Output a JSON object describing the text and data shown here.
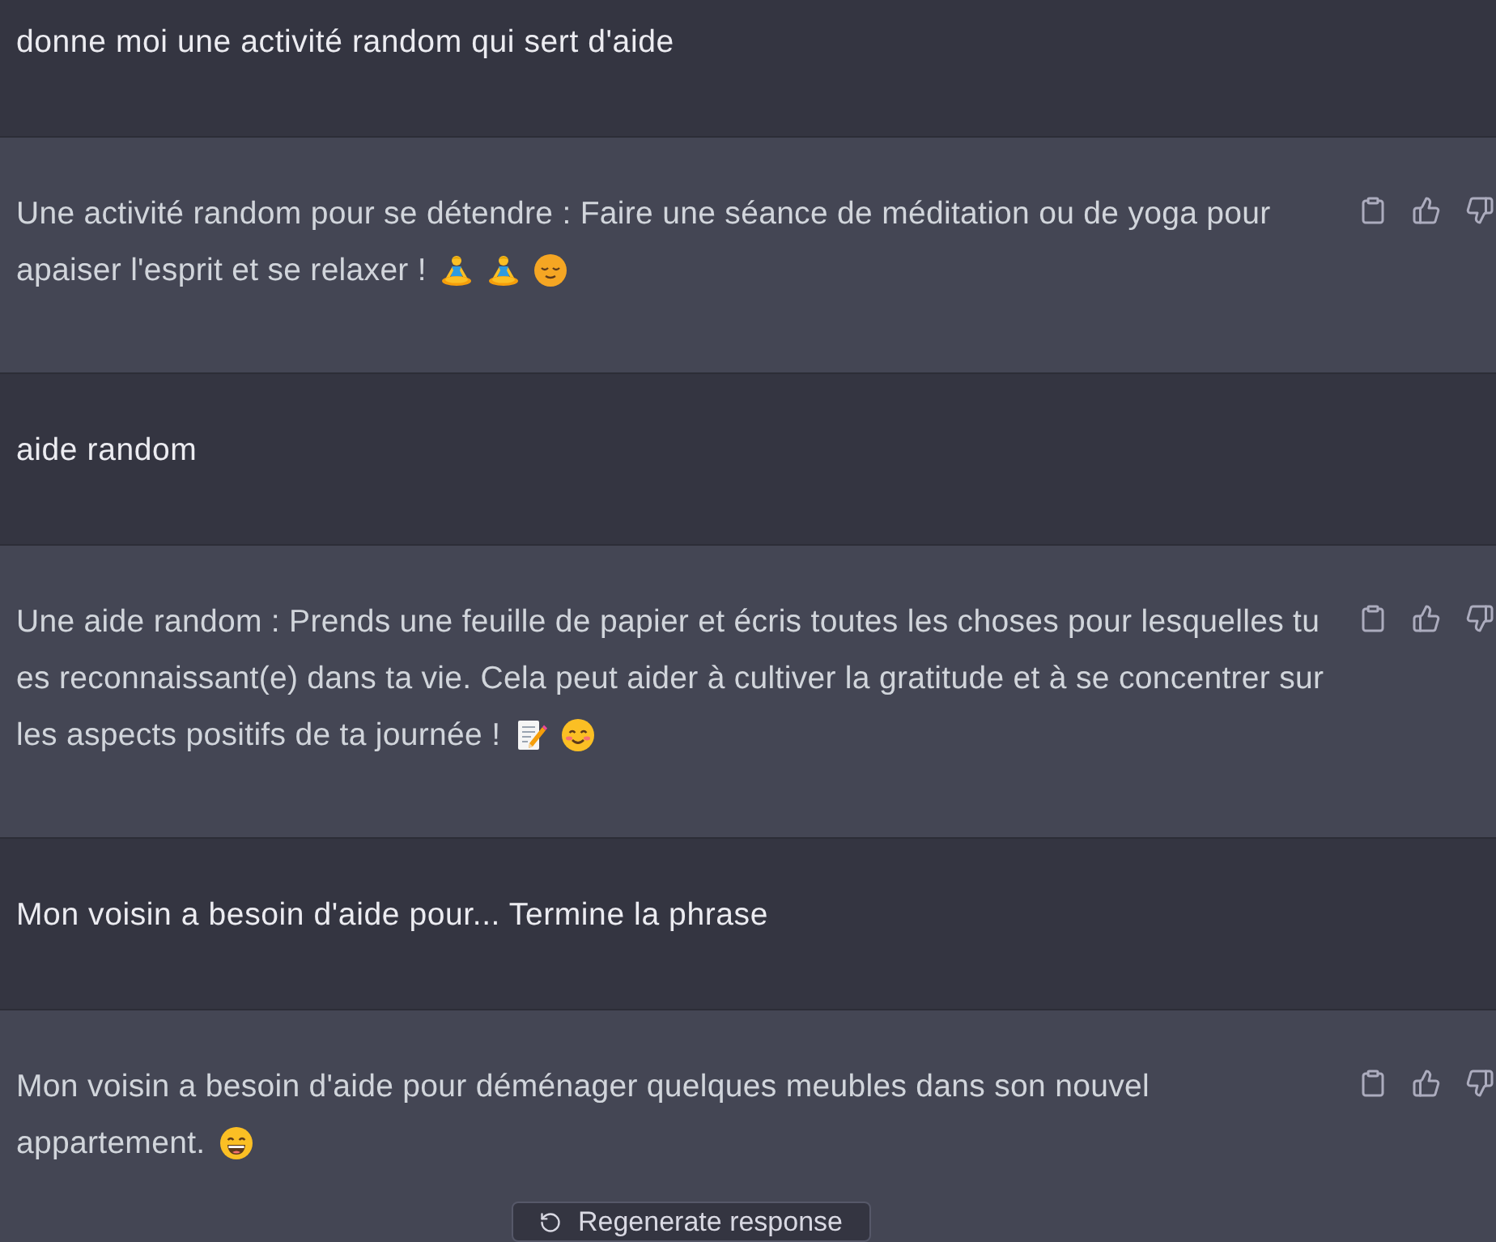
{
  "messages": [
    {
      "kind": "user",
      "text": "donne moi une activité random qui sert d'aide"
    },
    {
      "kind": "assistant",
      "text": "Une activité random pour se détendre : Faire une séance de méditation ou de yoga pour apaiser l'esprit et se relaxer !",
      "emojis": [
        {
          "kind": "meditation"
        },
        {
          "kind": "meditation"
        },
        {
          "kind": "relieved"
        }
      ]
    },
    {
      "kind": "user",
      "text": "aide random"
    },
    {
      "kind": "assistant",
      "text": "Une aide random : Prends une feuille de papier et écris toutes les choses pour lesquelles tu es reconnaissant(e) dans ta vie. Cela peut aider à cultiver la gratitude et à se concentrer sur les aspects positifs de ta journée !",
      "emojis": [
        {
          "kind": "memo"
        },
        {
          "kind": "smiling"
        }
      ]
    },
    {
      "kind": "user",
      "text": "Mon voisin a besoin d'aide pour... Termine la phrase"
    },
    {
      "kind": "assistant",
      "text": "Mon voisin a besoin d'aide pour déménager quelques meubles dans son nouvel appartement.",
      "emojis": [
        {
          "kind": "grinning"
        }
      ]
    }
  ],
  "regenerate_button": {
    "label": "Regenerate response"
  }
}
